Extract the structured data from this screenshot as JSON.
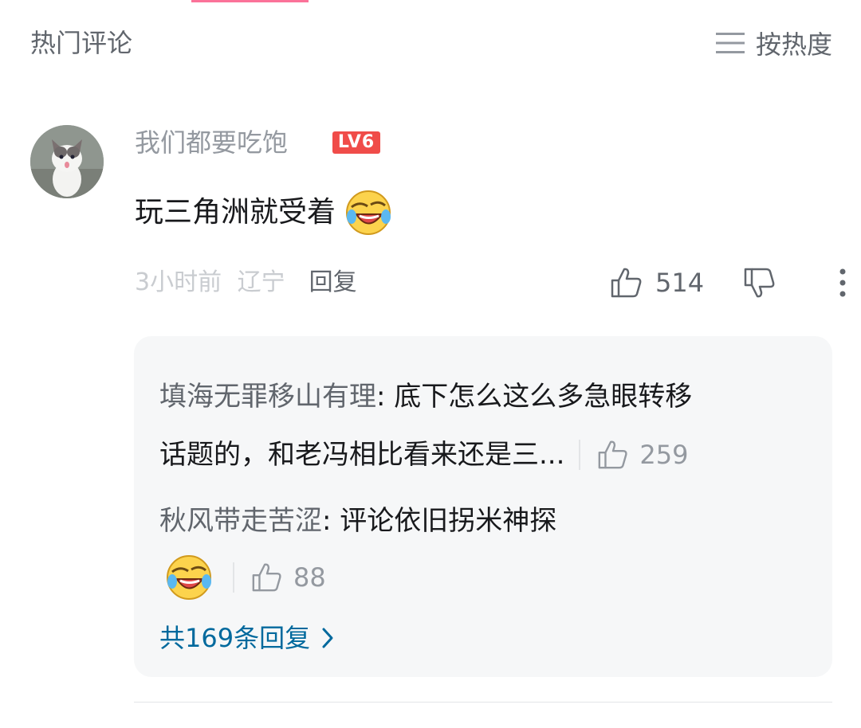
{
  "header": {
    "title": "热门评论",
    "sort_label": "按热度"
  },
  "comment": {
    "username": "我们都要吃饱",
    "level": "LV6",
    "text": "玩三角洲就受着",
    "time": "3小时前",
    "location": "辽宁",
    "reply_label": "回复",
    "likes": "514"
  },
  "replies": [
    {
      "name": "填海无罪移山有理",
      "line1": "底下怎么这么多急眼转移",
      "line2": "话题的，和老冯相比看来还是三...",
      "likes": "259"
    },
    {
      "name": "秋风带走苦涩",
      "text": "评论依旧拐米神探",
      "likes": "88"
    }
  ],
  "more_replies_label": "共169条回复",
  "colors": {
    "accent": "#fb7299",
    "link": "#00699d",
    "level_badge": "#f04c49"
  }
}
